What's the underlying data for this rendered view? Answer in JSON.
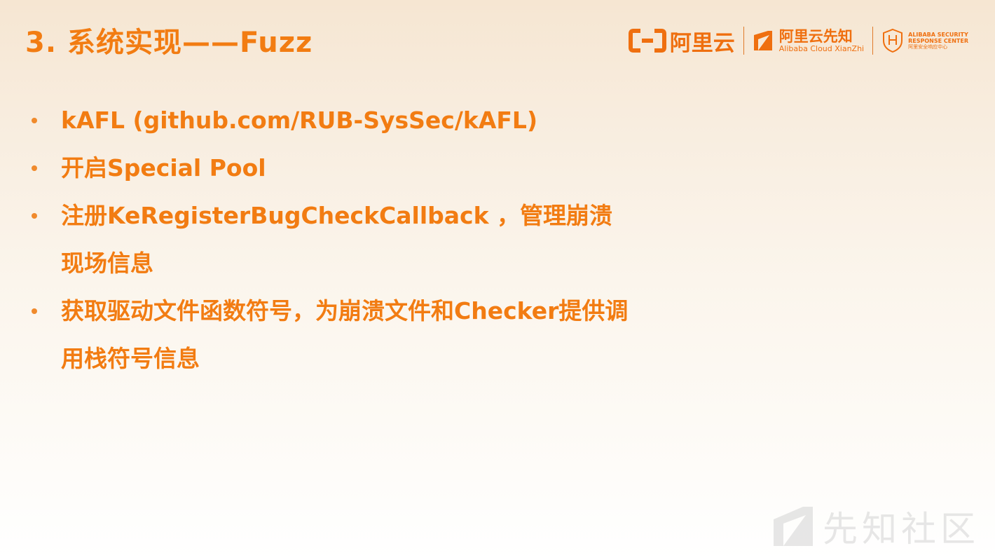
{
  "slide": {
    "title": "3. 系统实现——Fuzz",
    "bullets": [
      "kAFL (github.com/RUB-SysSec/kAFL)",
      "开启Special Pool",
      "注册KeRegisterBugCheckCallback ，管理崩溃现场信息",
      "获取驱动文件函数符号，为崩溃文件和Checker提供调用栈符号信息"
    ]
  },
  "logos": {
    "aliyun": "阿里云",
    "xianzhi_cn": "阿里云先知",
    "xianzhi_en": "Alibaba Cloud XianZhi",
    "asrc_line1": "ALIBABA SECURITY",
    "asrc_line2": "RESPONSE CENTER",
    "asrc_line3": "阿里安全响应中心"
  },
  "watermark": {
    "text": "先知社区"
  },
  "colors": {
    "accent": "#f27c12",
    "brand": "#ef6f0f"
  }
}
